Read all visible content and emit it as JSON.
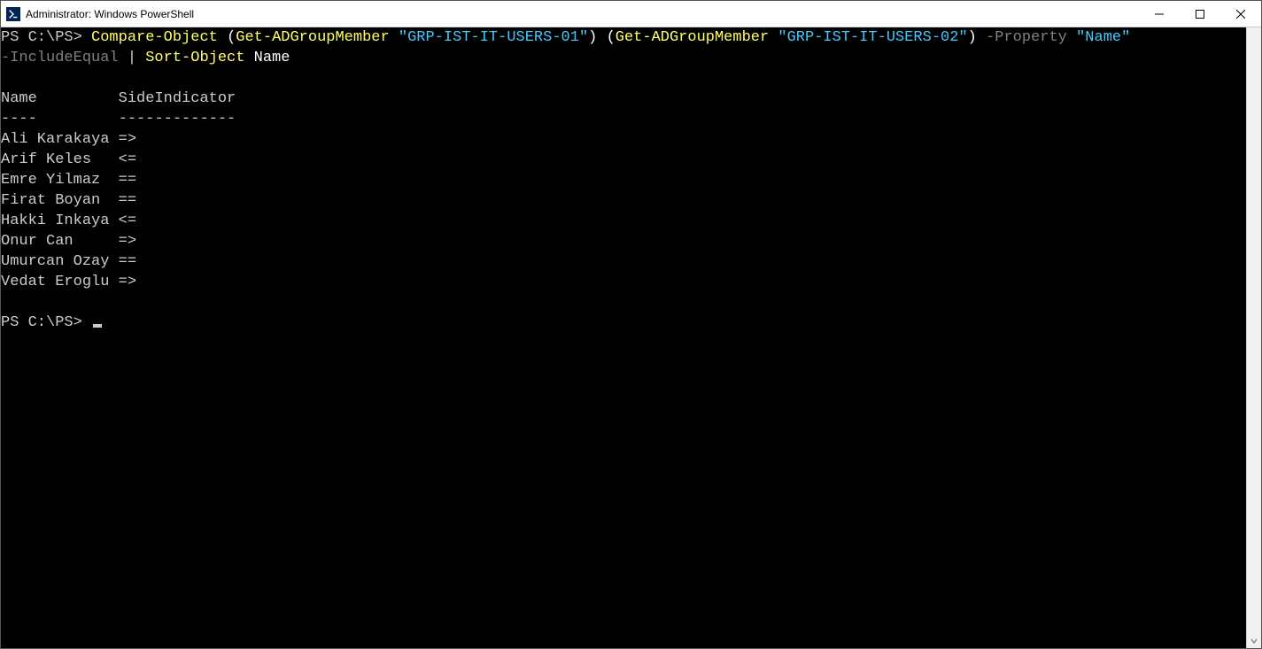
{
  "window": {
    "title": "Administrator: Windows PowerShell"
  },
  "terminal": {
    "prompt": "PS C:\\PS>",
    "command": {
      "cmdlet1": "Compare-Object",
      "paren1_open": "(",
      "cmdlet2": "Get-ADGroupMember",
      "string1": "\"GRP-IST-IT-USERS-01\"",
      "paren1_close": ")",
      "paren2_open": "(",
      "cmdlet3": "Get-ADGroupMember",
      "string2": "\"GRP-IST-IT-USERS-02\"",
      "paren2_close": ")",
      "param1": "-Property",
      "string3": "\"Name\"",
      "param2": "-IncludeEqual",
      "pipe": "|",
      "cmdlet4": "Sort-Object",
      "arg": "Name"
    },
    "output": {
      "header_name": "Name",
      "header_side": "SideIndicator",
      "sep_name": "----",
      "sep_side": "-------------",
      "rows": [
        {
          "name": "Ali Karakaya",
          "side": "=>"
        },
        {
          "name": "Arif Keles",
          "side": "<="
        },
        {
          "name": "Emre Yilmaz",
          "side": "=="
        },
        {
          "name": "Firat Boyan",
          "side": "=="
        },
        {
          "name": "Hakki Inkaya",
          "side": "<="
        },
        {
          "name": "Onur Can",
          "side": "=>"
        },
        {
          "name": "Umurcan Ozay",
          "side": "=="
        },
        {
          "name": "Vedat Eroglu",
          "side": "=>"
        }
      ]
    },
    "prompt2": "PS C:\\PS>"
  }
}
